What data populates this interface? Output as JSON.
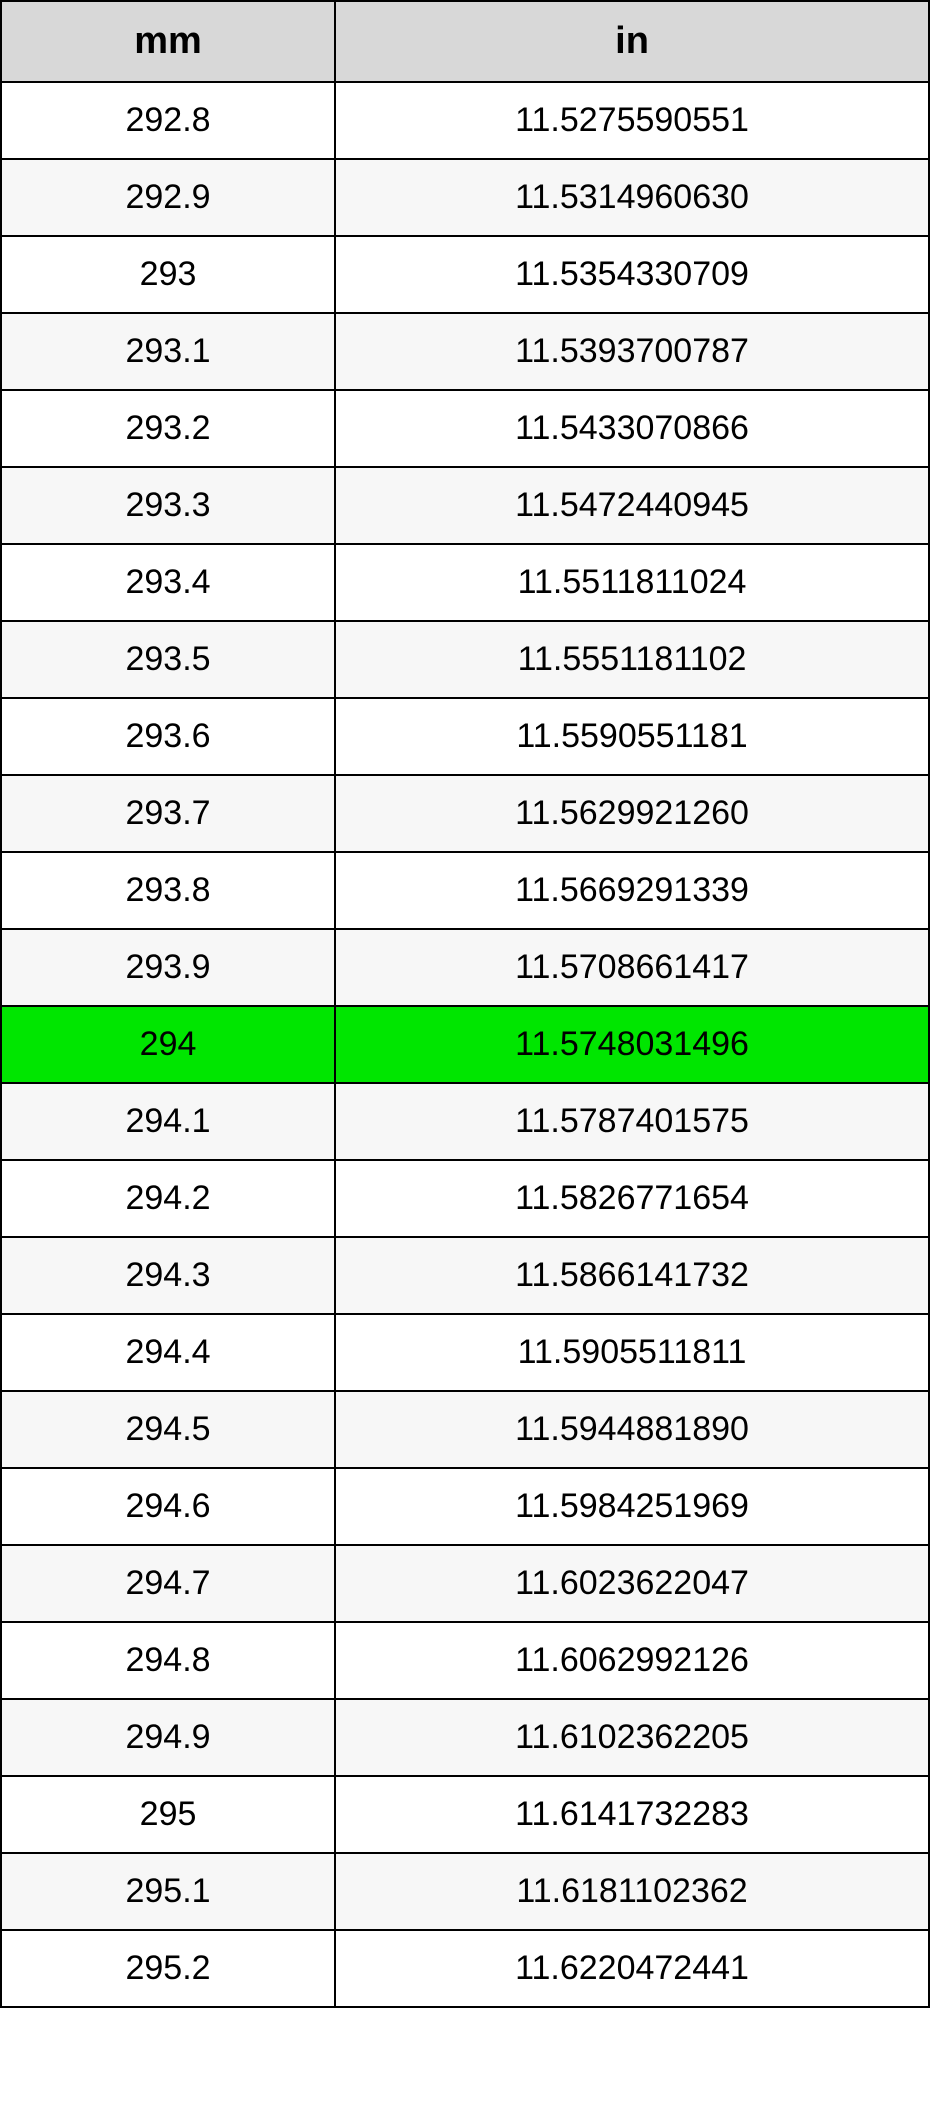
{
  "table": {
    "headers": {
      "mm": "mm",
      "in": "in"
    },
    "highlight_index": 12,
    "rows": [
      {
        "mm": "292.8",
        "in": "11.5275590551"
      },
      {
        "mm": "292.9",
        "in": "11.5314960630"
      },
      {
        "mm": "293",
        "in": "11.5354330709"
      },
      {
        "mm": "293.1",
        "in": "11.5393700787"
      },
      {
        "mm": "293.2",
        "in": "11.5433070866"
      },
      {
        "mm": "293.3",
        "in": "11.5472440945"
      },
      {
        "mm": "293.4",
        "in": "11.5511811024"
      },
      {
        "mm": "293.5",
        "in": "11.5551181102"
      },
      {
        "mm": "293.6",
        "in": "11.5590551181"
      },
      {
        "mm": "293.7",
        "in": "11.5629921260"
      },
      {
        "mm": "293.8",
        "in": "11.5669291339"
      },
      {
        "mm": "293.9",
        "in": "11.5708661417"
      },
      {
        "mm": "294",
        "in": "11.5748031496"
      },
      {
        "mm": "294.1",
        "in": "11.5787401575"
      },
      {
        "mm": "294.2",
        "in": "11.5826771654"
      },
      {
        "mm": "294.3",
        "in": "11.5866141732"
      },
      {
        "mm": "294.4",
        "in": "11.5905511811"
      },
      {
        "mm": "294.5",
        "in": "11.5944881890"
      },
      {
        "mm": "294.6",
        "in": "11.5984251969"
      },
      {
        "mm": "294.7",
        "in": "11.6023622047"
      },
      {
        "mm": "294.8",
        "in": "11.6062992126"
      },
      {
        "mm": "294.9",
        "in": "11.6102362205"
      },
      {
        "mm": "295",
        "in": "11.6141732283"
      },
      {
        "mm": "295.1",
        "in": "11.6181102362"
      },
      {
        "mm": "295.2",
        "in": "11.6220472441"
      }
    ]
  }
}
